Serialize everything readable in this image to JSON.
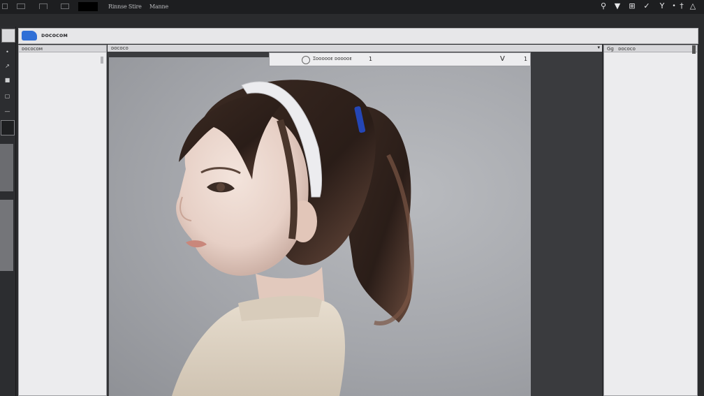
{
  "menubar": {
    "left_icons": [
      "window-icon",
      "grid-icon",
      "list-icon",
      "layers-icon"
    ],
    "menu_items": [
      "Rinnse Stire",
      "Manne"
    ],
    "right_icons": [
      "search-icon",
      "pin-icon",
      "crop-icon",
      "check-icon",
      "brush-icon",
      "dropper-icon",
      "warning-icon"
    ]
  },
  "app": {
    "name": "ᴅᴏᴄᴏᴄᴏᴍ"
  },
  "panels": {
    "left_header": "ᴅᴏᴄᴏᴄᴏᴍ",
    "canvas_header": "ᴅᴏᴄᴏᴄᴏ",
    "right_header": "ᴅᴏᴄᴏᴄᴏ",
    "right_badge": "Gg"
  },
  "dialog": {
    "title": "Ɪᴏᴏᴏᴏᴏᴇ ᴅᴏᴏᴏᴏᴇ",
    "suffix": "1",
    "chevron": "V",
    "count": "1"
  },
  "colors": {
    "menubar": "#1d1e20",
    "panel": "#ececee",
    "accent": "#2f6fd6",
    "headband": "#ececef"
  }
}
